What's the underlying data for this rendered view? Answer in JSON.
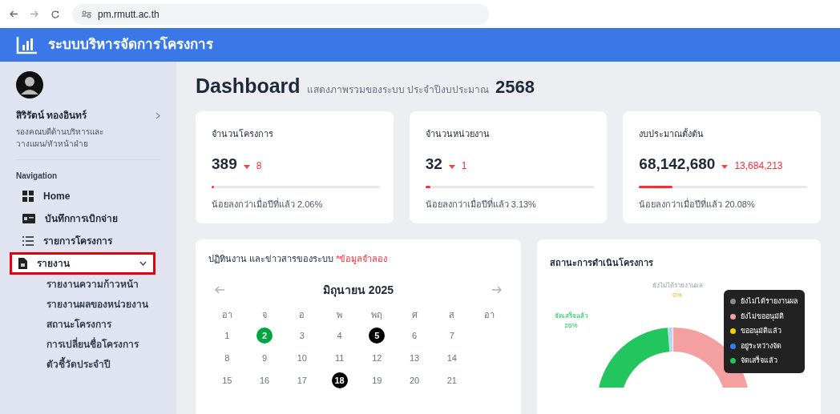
{
  "browser": {
    "url": "pm.rmutt.ac.th"
  },
  "header": {
    "title": "ระบบบริหารจัดการโครงการ"
  },
  "user": {
    "name": "สิริรัตน์ ทองอินทร์",
    "role": "รองคณบดีด้านบริหารและวางแผน/หัวหน้าฝ่าย"
  },
  "sidebar": {
    "section": "Navigation",
    "items": [
      {
        "label": "Home",
        "highlighted": false
      },
      {
        "label": "บันทึกการเบิกจ่าย",
        "highlighted": false
      },
      {
        "label": "รายการโครงการ",
        "highlighted": false
      },
      {
        "label": "รายงาน",
        "expanded": true,
        "highlighted": true,
        "children": [
          {
            "label": "รายงานความก้าวหน้า"
          },
          {
            "label": "รายงานผลของหน่วยงาน"
          },
          {
            "label": "สถานะโครงการ"
          },
          {
            "label": "การเปลี่ยนชื่อโครงการ"
          },
          {
            "label": "ตัวชี้วัดประจำปี"
          }
        ]
      }
    ]
  },
  "page": {
    "title": "Dashboard",
    "subtitle": "แสดงภาพรวมของระบบ ประจำปีงบประมาณ",
    "year": "2568"
  },
  "stats": [
    {
      "title": "จำนวนโครงการ",
      "value": "389",
      "change": "8",
      "level": 0.01,
      "note": "น้อยลงกว่าเมื่อปีที่แล้ว 2.06%"
    },
    {
      "title": "จำนวนหน่วยงาน",
      "value": "32",
      "change": "1",
      "level": 0.03,
      "note": "น้อยลงกว่าเมื่อปีที่แล้ว 3.13%"
    },
    {
      "title": "งบประมาณตั้งต้น",
      "value": "68,142,680",
      "change": "13,684,213",
      "level": 0.2,
      "note": "น้อยลงกว่าเมื่อปีที่แล้ว 20.08%"
    }
  ],
  "calendar": {
    "title": "ปฏิทินงาน และข่าวสารของระบบ",
    "note": "*ข้อมูลจำลอง",
    "month": "มิถุนายน 2025",
    "weekdays": [
      "อา",
      "จ",
      "อ",
      "พ",
      "พฤ",
      "ศ",
      "ส",
      "อา"
    ],
    "weeks": [
      [
        {
          "day": "1",
          "kind": "plain"
        },
        {
          "day": "2",
          "kind": "today"
        },
        {
          "day": "3",
          "kind": "plain"
        },
        {
          "day": "4",
          "kind": "plain"
        },
        {
          "day": "5",
          "kind": "event"
        },
        {
          "day": "6",
          "kind": "plain"
        },
        {
          "day": "7",
          "kind": "plain"
        }
      ],
      [
        {
          "day": "8",
          "kind": "plain"
        },
        {
          "day": "9",
          "kind": "plain"
        },
        {
          "day": "10",
          "kind": "plain"
        },
        {
          "day": "11",
          "kind": "plain"
        },
        {
          "day": "12",
          "kind": "plain"
        },
        {
          "day": "13",
          "kind": "plain"
        },
        {
          "day": "14",
          "kind": "plain"
        }
      ],
      [
        {
          "day": "15",
          "kind": "plain"
        },
        {
          "day": "16",
          "kind": "plain"
        },
        {
          "day": "17",
          "kind": "plain"
        },
        {
          "day": "18",
          "kind": "event"
        },
        {
          "day": "19",
          "kind": "plain"
        },
        {
          "day": "20",
          "kind": "plain"
        },
        {
          "day": "21",
          "kind": "plain"
        }
      ]
    ]
  },
  "status": {
    "title": "สถานะการดำเนินโครงการ",
    "labels": [
      {
        "text": "ยังไม่ได้รายงานผล",
        "value": "0%"
      },
      {
        "text": "จัดเสร็จแล้ว",
        "value": "26%"
      }
    ],
    "legend": [
      {
        "label": "ยังไม่ได้รายงานผล",
        "color": "#8a8a8a"
      },
      {
        "label": "ยังไม่ขออนุมัติ",
        "color": "#f4a0a0"
      },
      {
        "label": "ขออนุมัติแล้ว",
        "color": "#f5d000"
      },
      {
        "label": "อยู่ระหว่างจัด",
        "color": "#2f80ed"
      },
      {
        "label": "จัดเสร็จแล้ว",
        "color": "#22c55e"
      }
    ]
  }
}
